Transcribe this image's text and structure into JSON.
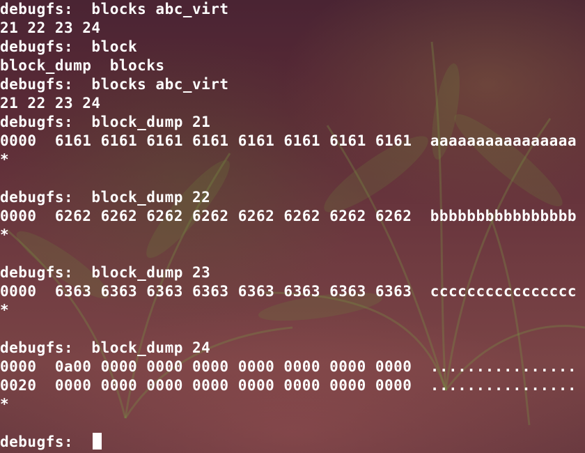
{
  "terminal": {
    "lines": [
      "debugfs:  blocks abc_virt",
      "21 22 23 24",
      "debugfs:  block",
      "block_dump  blocks",
      "debugfs:  blocks abc_virt",
      "21 22 23 24",
      "debugfs:  block_dump 21",
      "0000  6161 6161 6161 6161 6161 6161 6161 6161  aaaaaaaaaaaaaaaa",
      "*",
      "",
      "debugfs:  block_dump 22",
      "0000  6262 6262 6262 6262 6262 6262 6262 6262  bbbbbbbbbbbbbbbb",
      "*",
      "",
      "debugfs:  block_dump 23",
      "0000  6363 6363 6363 6363 6363 6363 6363 6363  cccccccccccccccc",
      "*",
      "",
      "debugfs:  block_dump 24",
      "0000  0a00 0000 0000 0000 0000 0000 0000 0000  ................",
      "0020  0000 0000 0000 0000 0000 0000 0000 0000  ................",
      "*",
      ""
    ],
    "prompt": "debugfs:  "
  }
}
